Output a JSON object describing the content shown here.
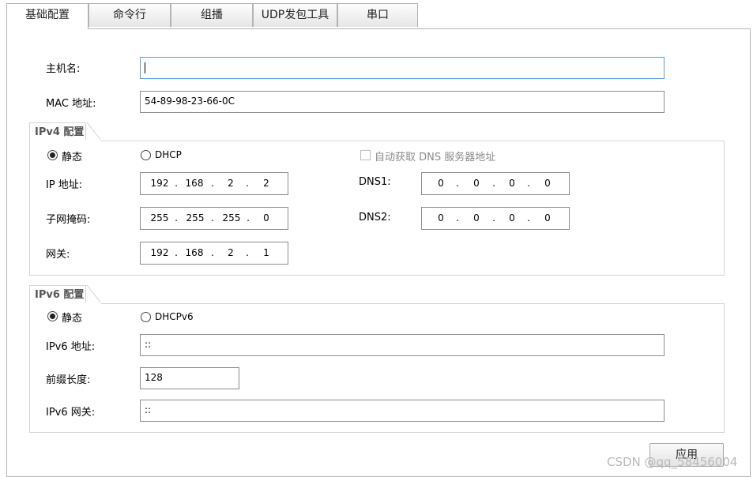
{
  "tabs": [
    {
      "label": "基础配置",
      "active": true
    },
    {
      "label": "命令行",
      "active": false
    },
    {
      "label": "组播",
      "active": false
    },
    {
      "label": "UDP发包工具",
      "active": false
    },
    {
      "label": "串口",
      "active": false
    }
  ],
  "hostname": {
    "label": "主机名:",
    "value": ""
  },
  "mac": {
    "label": "MAC 地址:",
    "value": "54-89-98-23-66-0C"
  },
  "ipv4": {
    "title": "IPv4 配置",
    "static_label": "静态",
    "dhcp_label": "DHCP",
    "auto_dns_label": "自动获取 DNS 服务器地址",
    "ip_label": "IP 地址:",
    "ip": [
      "192",
      "168",
      "2",
      "2"
    ],
    "mask_label": "子网掩码:",
    "mask": [
      "255",
      "255",
      "255",
      "0"
    ],
    "gateway_label": "网关:",
    "gateway": [
      "192",
      "168",
      "2",
      "1"
    ],
    "dns1_label": "DNS1:",
    "dns1": [
      "0",
      "0",
      "0",
      "0"
    ],
    "dns2_label": "DNS2:",
    "dns2": [
      "0",
      "0",
      "0",
      "0"
    ],
    "mode": "static"
  },
  "ipv6": {
    "title": "IPv6 配置",
    "static_label": "静态",
    "dhcp_label": "DHCPv6",
    "addr_label": "IPv6 地址:",
    "addr": "::",
    "prefix_label": "前缀长度:",
    "prefix": "128",
    "gateway_label": "IPv6 网关:",
    "gateway": "::",
    "mode": "static"
  },
  "apply_label": "应用",
  "watermark": "CSDN @qq_58456004"
}
